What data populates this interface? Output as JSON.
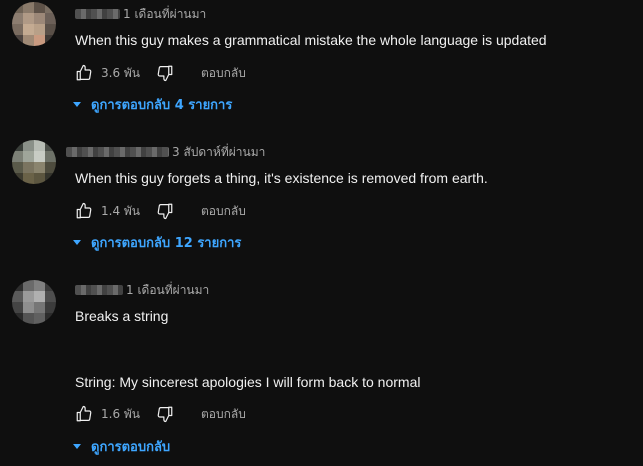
{
  "comments": [
    {
      "time": "1 เดือนที่ผ่านมา",
      "text": "When this guy makes a grammatical mistake the whole language is updated",
      "likes": "3.6 พัน",
      "reply_label": "ตอบกลับ",
      "replies_label": "ดูการตอบกลับ 4 รายการ"
    },
    {
      "time": "3 สัปดาห์ที่ผ่านมา",
      "text": "When this guy forgets a thing, it's existence is removed from earth.",
      "likes": "1.4 พัน",
      "reply_label": "ตอบกลับ",
      "replies_label": "ดูการตอบกลับ 12 รายการ"
    },
    {
      "time": "1 เดือนที่ผ่านมา",
      "text_line1": "Breaks a string",
      "text_line2": "String: My sincerest apologies I will form back to normal",
      "likes": "1.6 พัน",
      "reply_label": "ตอบกลับ",
      "replies_label": "ดูการตอบกลับ"
    }
  ],
  "colors": {
    "background": "#0f0f0f",
    "text": "#f1f1f1",
    "secondary": "#aaaaaa",
    "link": "#3ea6ff"
  },
  "icons": [
    "like-icon",
    "dislike-icon",
    "caret-down-icon"
  ]
}
